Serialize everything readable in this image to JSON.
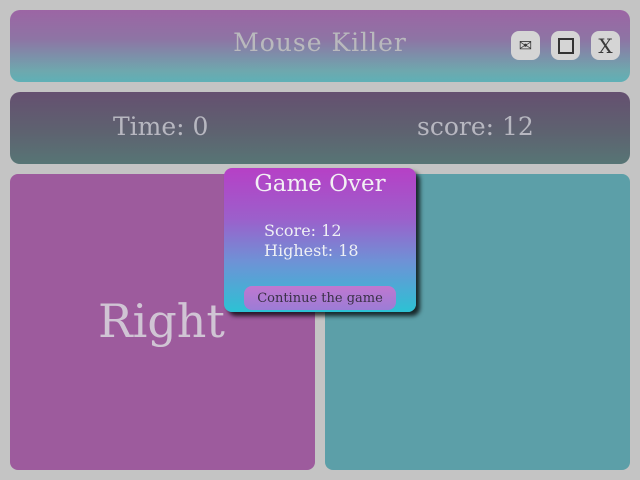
{
  "window": {
    "title": "Mouse Killer",
    "buttons": {
      "mail_icon": "✉",
      "close_label": "X"
    }
  },
  "status": {
    "time_text": "Time: 0",
    "score_text": "score: 12"
  },
  "board": {
    "left_label": "Right"
  },
  "dialog": {
    "title": "Game Over",
    "score_line": "Score: 12",
    "highest_line": "Highest: 18",
    "continue_label": "Continue the game"
  },
  "colors": {
    "left_panel": "#9d5b9d",
    "right_panel": "#5c9fa8"
  }
}
